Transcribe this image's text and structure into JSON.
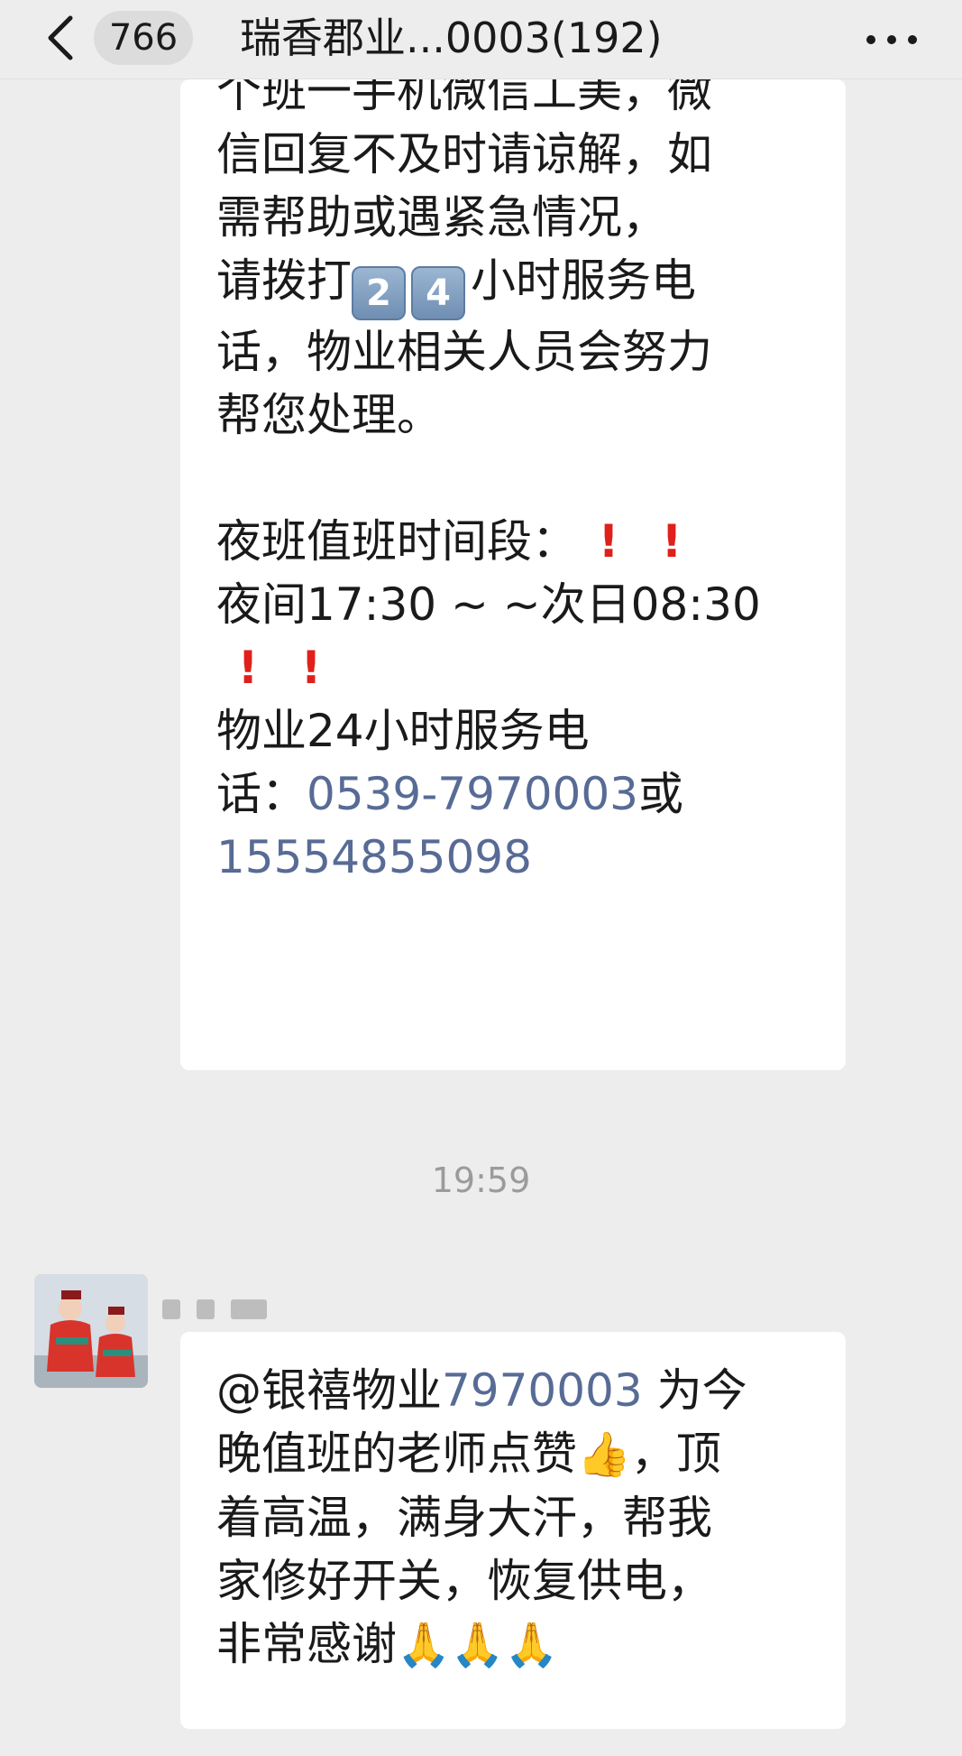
{
  "header": {
    "unread_count": "766",
    "title": "瑞香郡业...0003(192)"
  },
  "messages": [
    {
      "lines": [
        "个班一手机微信工美，微",
        "信回复不及时请谅解，如",
        "需帮助或遇紧急情况，",
        "小时服务电",
        "话，物业相关人员会努力",
        "帮您处理。",
        "夜班值班时间段：",
        "夜间17:30 ~ ~次日08:30",
        "物业24小时服务电",
        "话：",
        "0539-7970003",
        "或",
        "15554855098"
      ],
      "line4_prefix": "请拨打",
      "keycaps": [
        "2",
        "4"
      ]
    },
    {
      "time": "19:59",
      "text_mention": "@银禧物业",
      "mention_link": "7970003",
      "line1_rest": " 为今",
      "line2": "晚值班的老师点赞",
      "line2_rest": "，顶",
      "line3": "着高温，满身大汗，帮我",
      "line4": "家修好开关，恢复供电，",
      "line5": "非常感谢"
    }
  ],
  "icons": {
    "back": "chevron-left-icon",
    "more": "more-dots-icon",
    "thumbs_up": "thumbs-up-emoji",
    "pray": "pray-emoji"
  },
  "colors": {
    "background": "#ededed",
    "bubble": "#ffffff",
    "link": "#576b95",
    "alert": "#e0201b"
  }
}
